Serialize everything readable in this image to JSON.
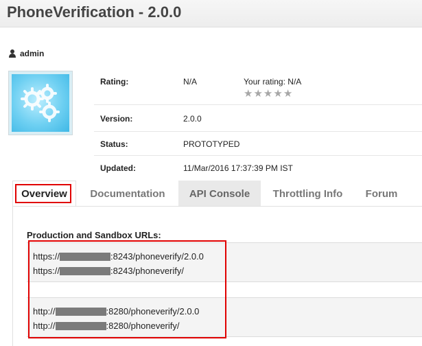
{
  "page": {
    "title": "PhoneVerification - 2.0.0",
    "owner": "admin"
  },
  "info": {
    "rating_label": "Rating:",
    "rating_value": "N/A",
    "your_rating_label": "Your rating:",
    "your_rating_value": "N/A",
    "stars_total": 5,
    "stars_filled": 0,
    "version_label": "Version:",
    "version_value": "2.0.0",
    "status_label": "Status:",
    "status_value": "PROTOTYPED",
    "updated_label": "Updated:",
    "updated_value": "11/Mar/2016 17:37:39 PM IST"
  },
  "tabs": [
    {
      "label": "Overview",
      "active": true
    },
    {
      "label": "Documentation",
      "active": false
    },
    {
      "label": "API Console",
      "active": false
    },
    {
      "label": "Throttling Info",
      "active": false
    },
    {
      "label": "Forum",
      "active": false
    }
  ],
  "urls": {
    "title": "Production and Sandbox URLs:",
    "https": [
      {
        "prefix": "https://",
        "suffix": ":8243/phoneverify/2.0.0"
      },
      {
        "prefix": "https://",
        "suffix": ":8243/phoneverify/"
      }
    ],
    "http": [
      {
        "prefix": "http://",
        "suffix": ":8280/phoneverify/2.0.0"
      },
      {
        "prefix": "http://",
        "suffix": ":8280/phoneverify/"
      }
    ]
  },
  "colors": {
    "highlight": "#e00000",
    "redacted": "#7b7b7b",
    "star": "#a7a7a7",
    "tab_grey": "#e9e9e9"
  }
}
